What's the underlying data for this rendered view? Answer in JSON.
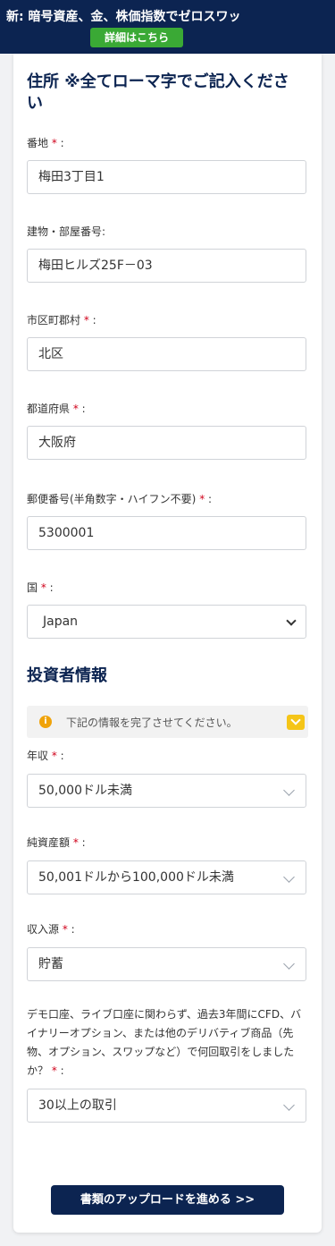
{
  "banner": {
    "prefix": "新:",
    "text": " 暗号資産、金、株価指数でゼロスワッ",
    "button_label": "詳細はこちら"
  },
  "address": {
    "title": "住所 ※全てローマ字でご記入ください",
    "street": {
      "label": "番地",
      "required": "*",
      "suffix": " :",
      "value": "梅田3丁目1"
    },
    "building": {
      "label": "建物・部屋番号:",
      "value": "梅田ヒルズ25F－03"
    },
    "city": {
      "label": "市区町郡村",
      "required": "*",
      "suffix": " :",
      "value": "北区"
    },
    "prefecture": {
      "label": "都道府県",
      "required": "*",
      "suffix": " :",
      "value": "大阪府"
    },
    "postal": {
      "label": "郵便番号(半角数字・ハイフン不要)",
      "required": "*",
      "suffix": " :",
      "value": "5300001"
    },
    "country": {
      "label": "国",
      "required": "*",
      "suffix": " :",
      "value": "Japan"
    }
  },
  "investor": {
    "title": "投資者情報",
    "notice": "下記の情報を完了させてください。",
    "income": {
      "label": "年収",
      "required": "*",
      "suffix": " :",
      "value": "50,000ドル未満"
    },
    "net_worth": {
      "label": "純資産額",
      "required": "*",
      "suffix": " :",
      "value": "50,001ドルから100,000ドル未満"
    },
    "source": {
      "label": "収入源",
      "required": "*",
      "suffix": " :",
      "value": "貯蓄"
    },
    "trades": {
      "question": "デモ口座、ライブ口座に関わらず、過去3年間にCFD、バイナリーオプション、または他のデリバティブ商品（先物、オプション、スワップなど）で何回取引をしましたか？",
      "required": "*",
      "suffix": " :",
      "value": "30以上の取引"
    }
  },
  "submit_label": "書類のアップロードを進める >>",
  "colors": {
    "navy": "#0c2451",
    "green": "#3aa935",
    "required": "#d0021b",
    "warning": "#f0a30a"
  }
}
